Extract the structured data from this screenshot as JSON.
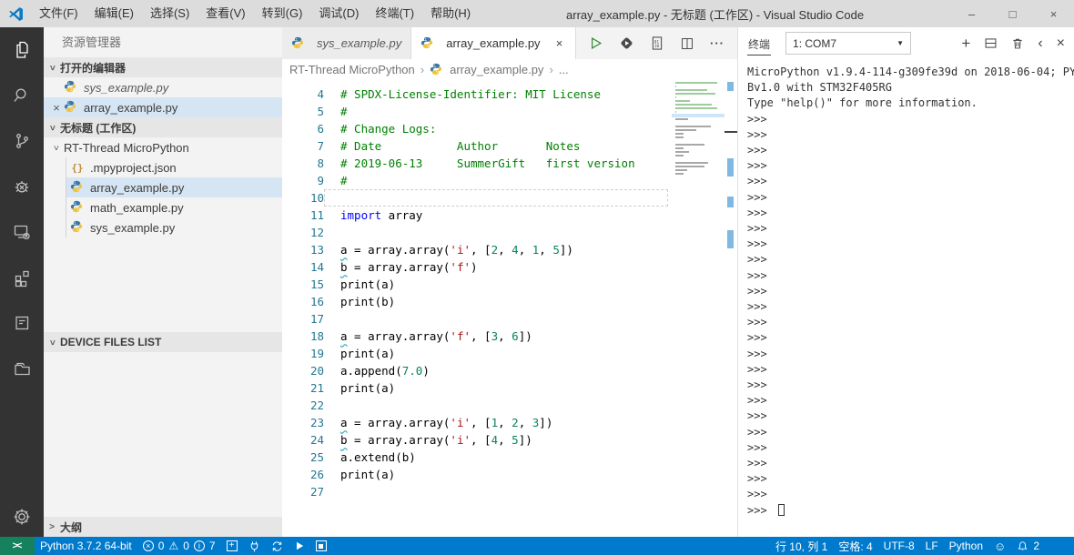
{
  "window": {
    "title": "array_example.py - 无标题 (工作区) - Visual Studio Code",
    "menus": [
      "文件(F)",
      "编辑(E)",
      "选择(S)",
      "查看(V)",
      "转到(G)",
      "调试(D)",
      "终端(T)",
      "帮助(H)"
    ],
    "controls": {
      "minimize": "–",
      "maximize": "□",
      "close": "×"
    }
  },
  "activity_bar": {
    "items": [
      "explorer",
      "search",
      "source-control",
      "debug",
      "device-remote",
      "extensions",
      "output-notes",
      "folder",
      "settings-gear"
    ]
  },
  "sidebar": {
    "title": "资源管理器",
    "open_editors": {
      "header": "打开的编辑器",
      "items": [
        {
          "label": "sys_example.py",
          "preview": true
        },
        {
          "label": "array_example.py",
          "active": true
        }
      ]
    },
    "workspace": {
      "header": "无标题 (工作区)",
      "folder": "RT-Thread MicroPython",
      "files": [
        {
          "label": ".mpyproject.json",
          "icon": "json"
        },
        {
          "label": "array_example.py",
          "icon": "python",
          "selected": true
        },
        {
          "label": "math_example.py",
          "icon": "python"
        },
        {
          "label": "sys_example.py",
          "icon": "python"
        }
      ]
    },
    "device_files_header": "DEVICE FILES LIST",
    "outline_header": "大纲"
  },
  "editor": {
    "tabs": [
      {
        "label": "sys_example.py",
        "preview": true
      },
      {
        "label": "array_example.py",
        "active": true
      }
    ],
    "breadcrumb": [
      "RT-Thread MicroPython",
      "array_example.py",
      "..."
    ],
    "lines": [
      {
        "n": 4,
        "tk": [
          [
            "c",
            "# SPDX-License-Identifier: MIT License"
          ]
        ]
      },
      {
        "n": 5,
        "tk": [
          [
            "c",
            "#"
          ]
        ]
      },
      {
        "n": 6,
        "tk": [
          [
            "c",
            "# Change Logs:"
          ]
        ]
      },
      {
        "n": 7,
        "tk": [
          [
            "c",
            "# Date           Author       Notes"
          ]
        ]
      },
      {
        "n": 8,
        "tk": [
          [
            "c",
            "# 2019-06-13     SummerGift   first version"
          ]
        ]
      },
      {
        "n": 9,
        "tk": [
          [
            "c",
            "#"
          ]
        ]
      },
      {
        "n": 10,
        "tk": [],
        "cur": true
      },
      {
        "n": 11,
        "tk": [
          [
            "k",
            "import"
          ],
          [
            "p",
            " array"
          ]
        ]
      },
      {
        "n": 12,
        "tk": []
      },
      {
        "n": 13,
        "tk": [
          [
            "v",
            "a"
          ],
          [
            "p",
            " = array.array("
          ],
          [
            "s",
            "'i'"
          ],
          [
            "p",
            ", ["
          ],
          [
            "n",
            "2"
          ],
          [
            "p",
            ", "
          ],
          [
            "n",
            "4"
          ],
          [
            "p",
            ", "
          ],
          [
            "n",
            "1"
          ],
          [
            "p",
            ", "
          ],
          [
            "n",
            "5"
          ],
          [
            "p",
            "])"
          ]
        ]
      },
      {
        "n": 14,
        "tk": [
          [
            "v",
            "b"
          ],
          [
            "p",
            " = array.array("
          ],
          [
            "s",
            "'f'"
          ],
          [
            "p",
            ")"
          ]
        ]
      },
      {
        "n": 15,
        "tk": [
          [
            "p",
            "print(a)"
          ]
        ]
      },
      {
        "n": 16,
        "tk": [
          [
            "p",
            "print(b)"
          ]
        ]
      },
      {
        "n": 17,
        "tk": []
      },
      {
        "n": 18,
        "tk": [
          [
            "v",
            "a"
          ],
          [
            "p",
            " = array.array("
          ],
          [
            "s",
            "'f'"
          ],
          [
            "p",
            ", ["
          ],
          [
            "n",
            "3"
          ],
          [
            "p",
            ", "
          ],
          [
            "n",
            "6"
          ],
          [
            "p",
            "])"
          ]
        ]
      },
      {
        "n": 19,
        "tk": [
          [
            "p",
            "print(a)"
          ]
        ]
      },
      {
        "n": 20,
        "tk": [
          [
            "p",
            "a.append("
          ],
          [
            "n",
            "7.0"
          ],
          [
            "p",
            ")"
          ]
        ]
      },
      {
        "n": 21,
        "tk": [
          [
            "p",
            "print(a)"
          ]
        ]
      },
      {
        "n": 22,
        "tk": []
      },
      {
        "n": 23,
        "tk": [
          [
            "v",
            "a"
          ],
          [
            "p",
            " = array.array("
          ],
          [
            "s",
            "'i'"
          ],
          [
            "p",
            ", ["
          ],
          [
            "n",
            "1"
          ],
          [
            "p",
            ", "
          ],
          [
            "n",
            "2"
          ],
          [
            "p",
            ", "
          ],
          [
            "n",
            "3"
          ],
          [
            "p",
            "])"
          ]
        ]
      },
      {
        "n": 24,
        "tk": [
          [
            "v",
            "b"
          ],
          [
            "p",
            " = array.array("
          ],
          [
            "s",
            "'i'"
          ],
          [
            "p",
            ", ["
          ],
          [
            "n",
            "4"
          ],
          [
            "p",
            ", "
          ],
          [
            "n",
            "5"
          ],
          [
            "p",
            "])"
          ]
        ]
      },
      {
        "n": 25,
        "tk": [
          [
            "p",
            "a.extend(b)"
          ]
        ]
      },
      {
        "n": 26,
        "tk": [
          [
            "p",
            "print(a)"
          ]
        ]
      },
      {
        "n": 27,
        "tk": []
      }
    ]
  },
  "terminal": {
    "tab": "终端",
    "dropdown": "1: COM7",
    "banner": [
      "MicroPython v1.9.4-114-g309fe39d on 2018-06-04; PY",
      "Bv1.0 with STM32F405RG",
      "Type \"help()\" for more information."
    ],
    "prompt": ">>>",
    "prompt_count": 26
  },
  "status_bar": {
    "interpreter": "Python 3.7.2 64-bit",
    "errors": "0",
    "warnings": "0",
    "infos": "7",
    "line_col": "行 10, 列 1",
    "indent": "空格: 4",
    "encoding": "UTF-8",
    "eol": "LF",
    "language": "Python",
    "bell_count": "2"
  },
  "colors": {
    "status_bar": "#007acc",
    "remote_segment": "#16825d",
    "activity_bar": "#333333",
    "selection": "#d6e5f3"
  }
}
